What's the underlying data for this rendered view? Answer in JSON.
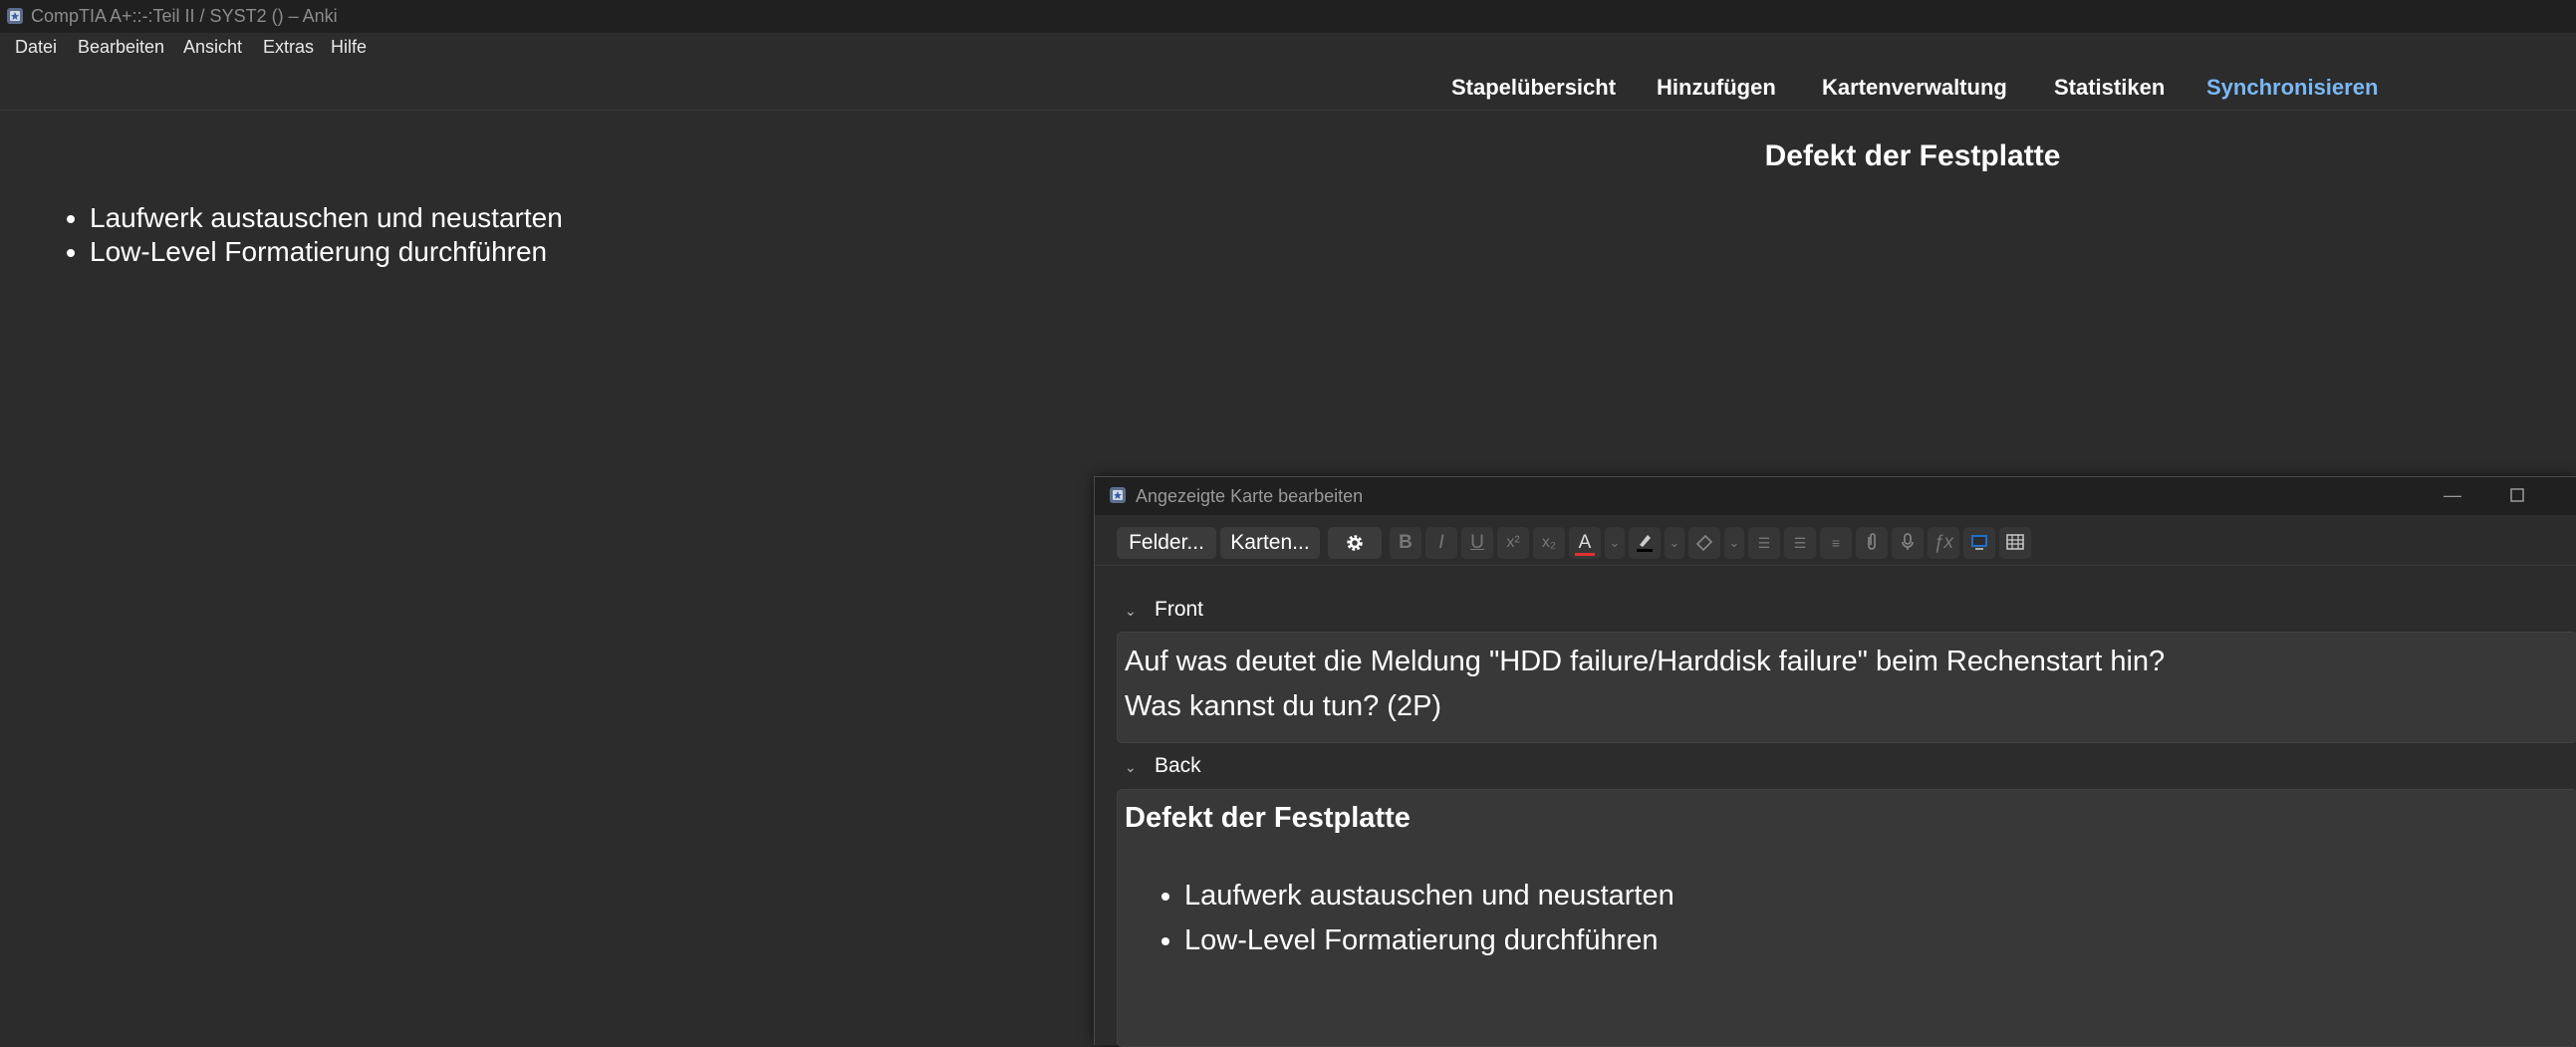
{
  "window": {
    "title": "CompTIA A+::-:Teil II / SYST2 () – Anki"
  },
  "menu": [
    "Datei",
    "Bearbeiten",
    "Ansicht",
    "Extras",
    "Hilfe"
  ],
  "nav": [
    "Stapelübersicht",
    "Hinzufügen",
    "Kartenverwaltung",
    "Statistiken",
    "Synchronisieren"
  ],
  "card": {
    "answer_title": "Defekt der Festplatte",
    "bullets": [
      "Laufwerk austauschen und neustarten",
      "Low-Level Formatierung durchführen"
    ]
  },
  "editor": {
    "title": "Angezeigte Karte bearbeiten",
    "buttons": {
      "fields": "Felder...",
      "cards": "Karten..."
    },
    "fields": {
      "front_label": "Front",
      "front_lines": [
        "Auf was deutet die Meldung \"HDD failure/Harddisk failure\" beim Rechenstart hin?",
        "Was kannst du tun? (2P)"
      ],
      "back_label": "Back",
      "back_heading": "Defekt der Festplatte",
      "back_bullets": [
        "Laufwerk austauschen und neustarten",
        "Low-Level Formatierung durchführen"
      ]
    }
  },
  "colors": {
    "accent": "#7ab8f5",
    "text_color_indicator": "#e03030",
    "background": "#2c2c2c"
  },
  "icons": [
    "gear-icon",
    "bold-icon",
    "italic-icon",
    "underline-icon",
    "superscript-icon",
    "subscript-icon",
    "text-color-icon",
    "highlight-icon",
    "eraser-icon",
    "bullet-list-icon",
    "numbered-list-icon",
    "align-icon",
    "paperclip-icon",
    "microphone-icon",
    "math-icon",
    "html-editor-icon",
    "table-icon"
  ]
}
